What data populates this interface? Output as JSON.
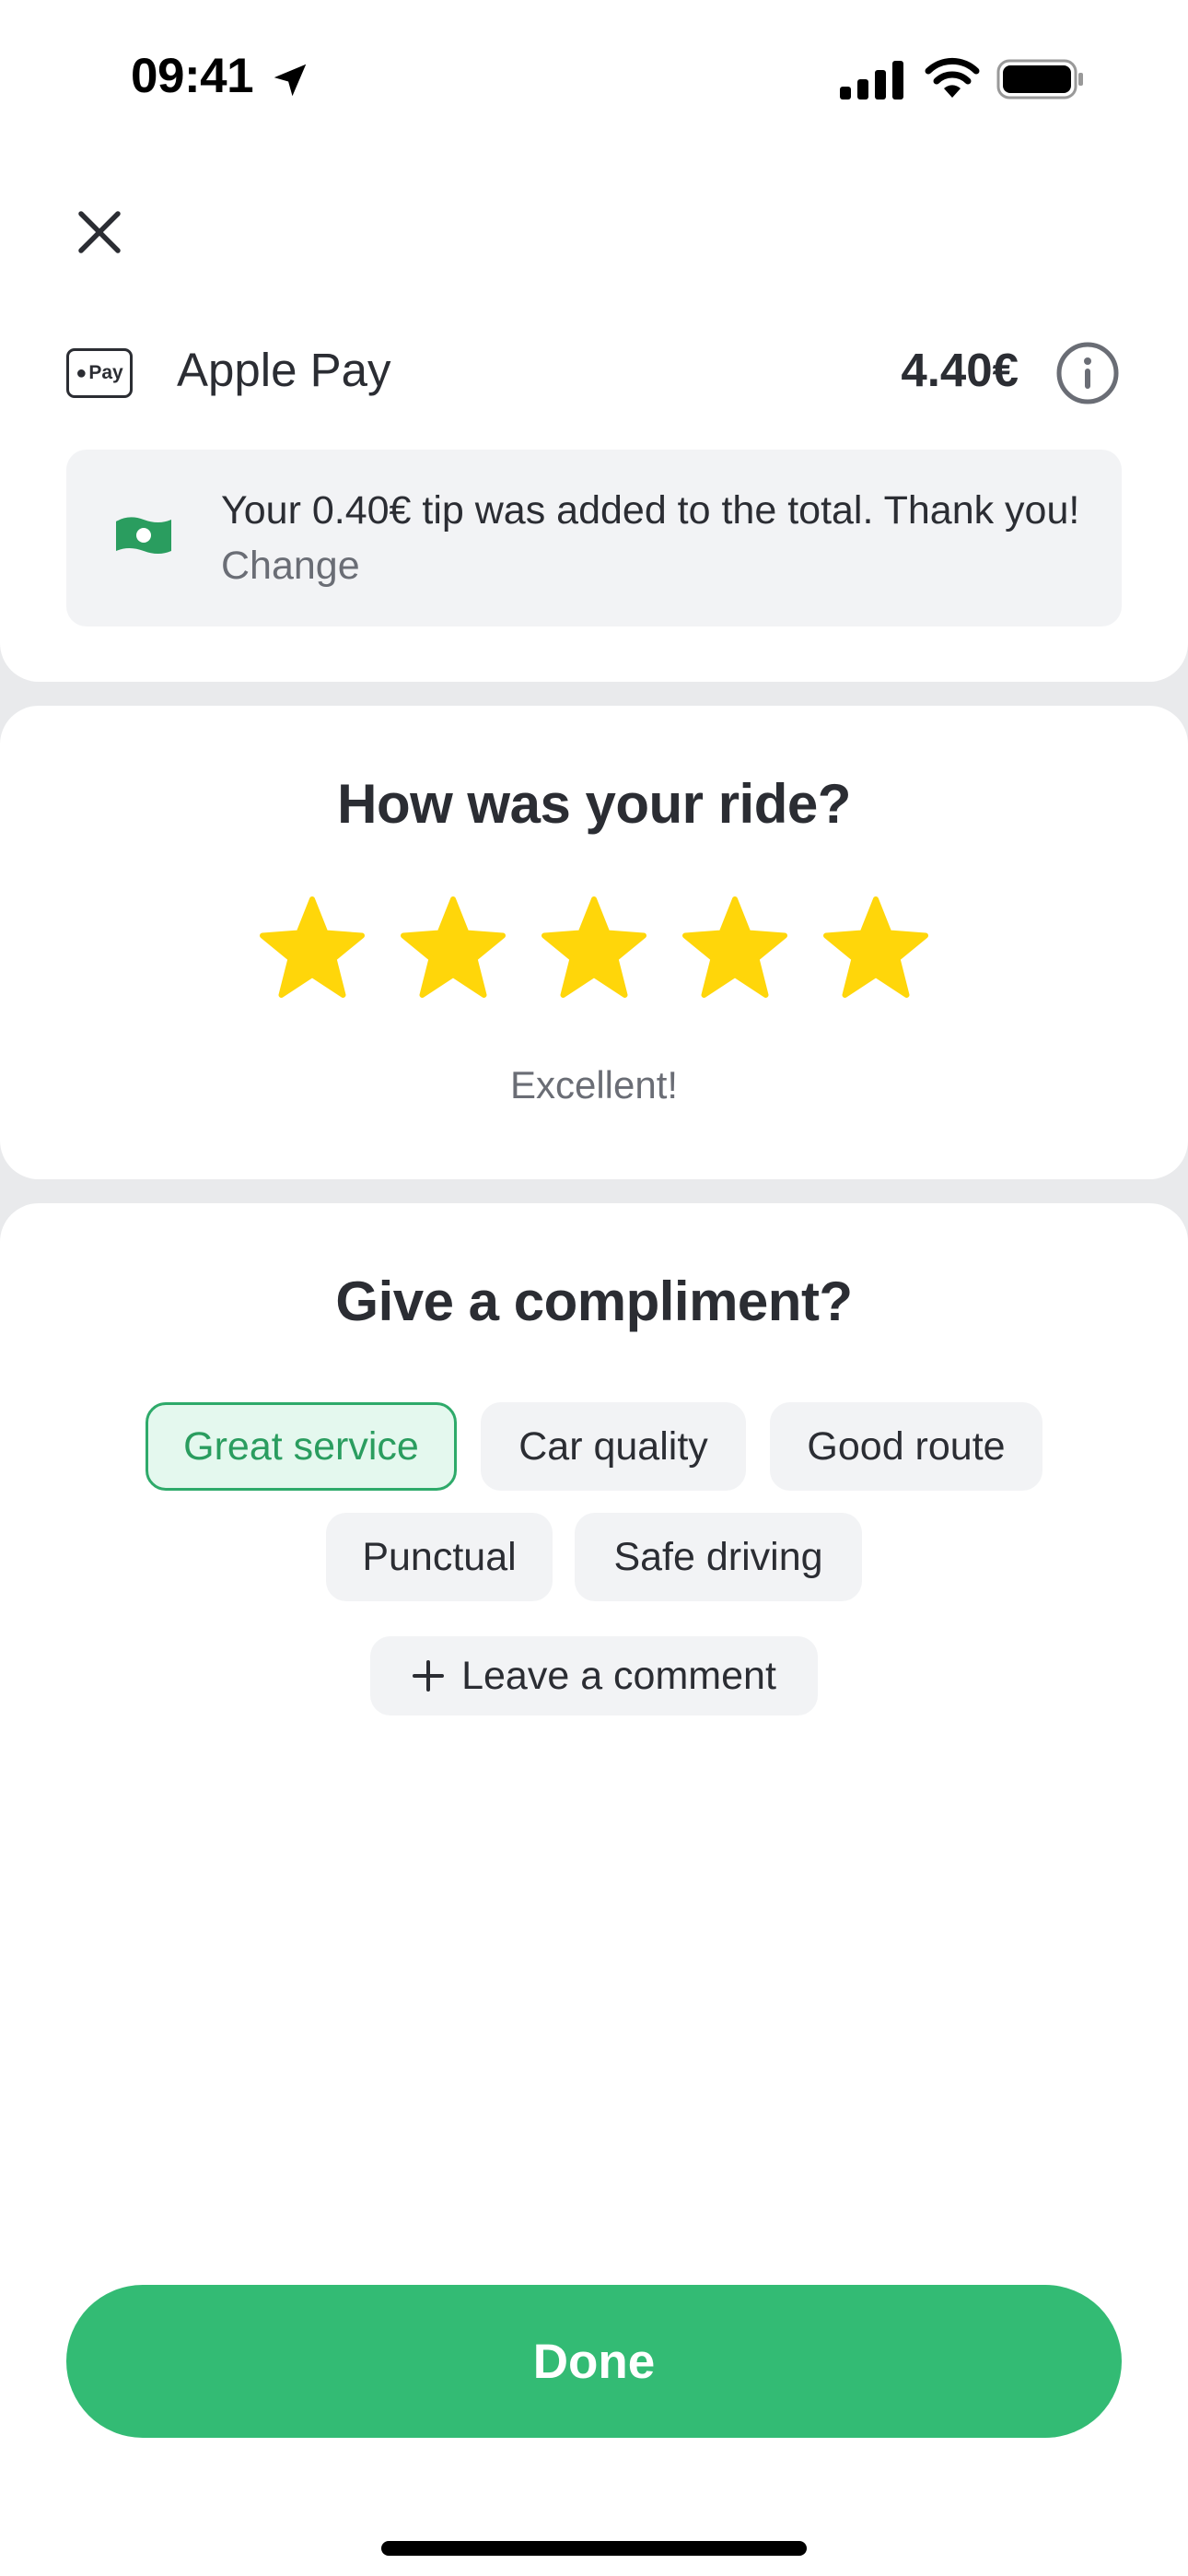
{
  "status_bar": {
    "time": "09:41",
    "icons": [
      "location-arrow-icon",
      "cellular-signal-icon",
      "wifi-icon",
      "battery-icon"
    ]
  },
  "header": {
    "close_icon": "close-icon"
  },
  "payment": {
    "method_logo_text": "Pay",
    "method_label": "Apple Pay",
    "amount": "4.40€",
    "info_icon": "info-icon"
  },
  "tip_notice": {
    "icon": "money-icon",
    "message": "Your 0.40€ tip was added to the total. Thank you!",
    "change_link": "Change"
  },
  "rating": {
    "title": "How was your ride?",
    "stars_total": 5,
    "stars_selected": 5,
    "result_label": "Excellent!"
  },
  "compliments": {
    "title": "Give a compliment?",
    "chips": [
      {
        "label": "Great service",
        "selected": true
      },
      {
        "label": "Car quality",
        "selected": false
      },
      {
        "label": "Good route",
        "selected": false
      },
      {
        "label": "Punctual",
        "selected": false
      },
      {
        "label": "Safe driving",
        "selected": false
      }
    ],
    "comment_button": "Leave a comment"
  },
  "footer": {
    "done_label": "Done"
  },
  "colors": {
    "accent_green": "#33bb74",
    "star_yellow": "#ffd60a",
    "selected_chip_bg": "#e4f8ee",
    "selected_chip_border": "#2eaa6a",
    "background_gray": "#e9eaec"
  }
}
